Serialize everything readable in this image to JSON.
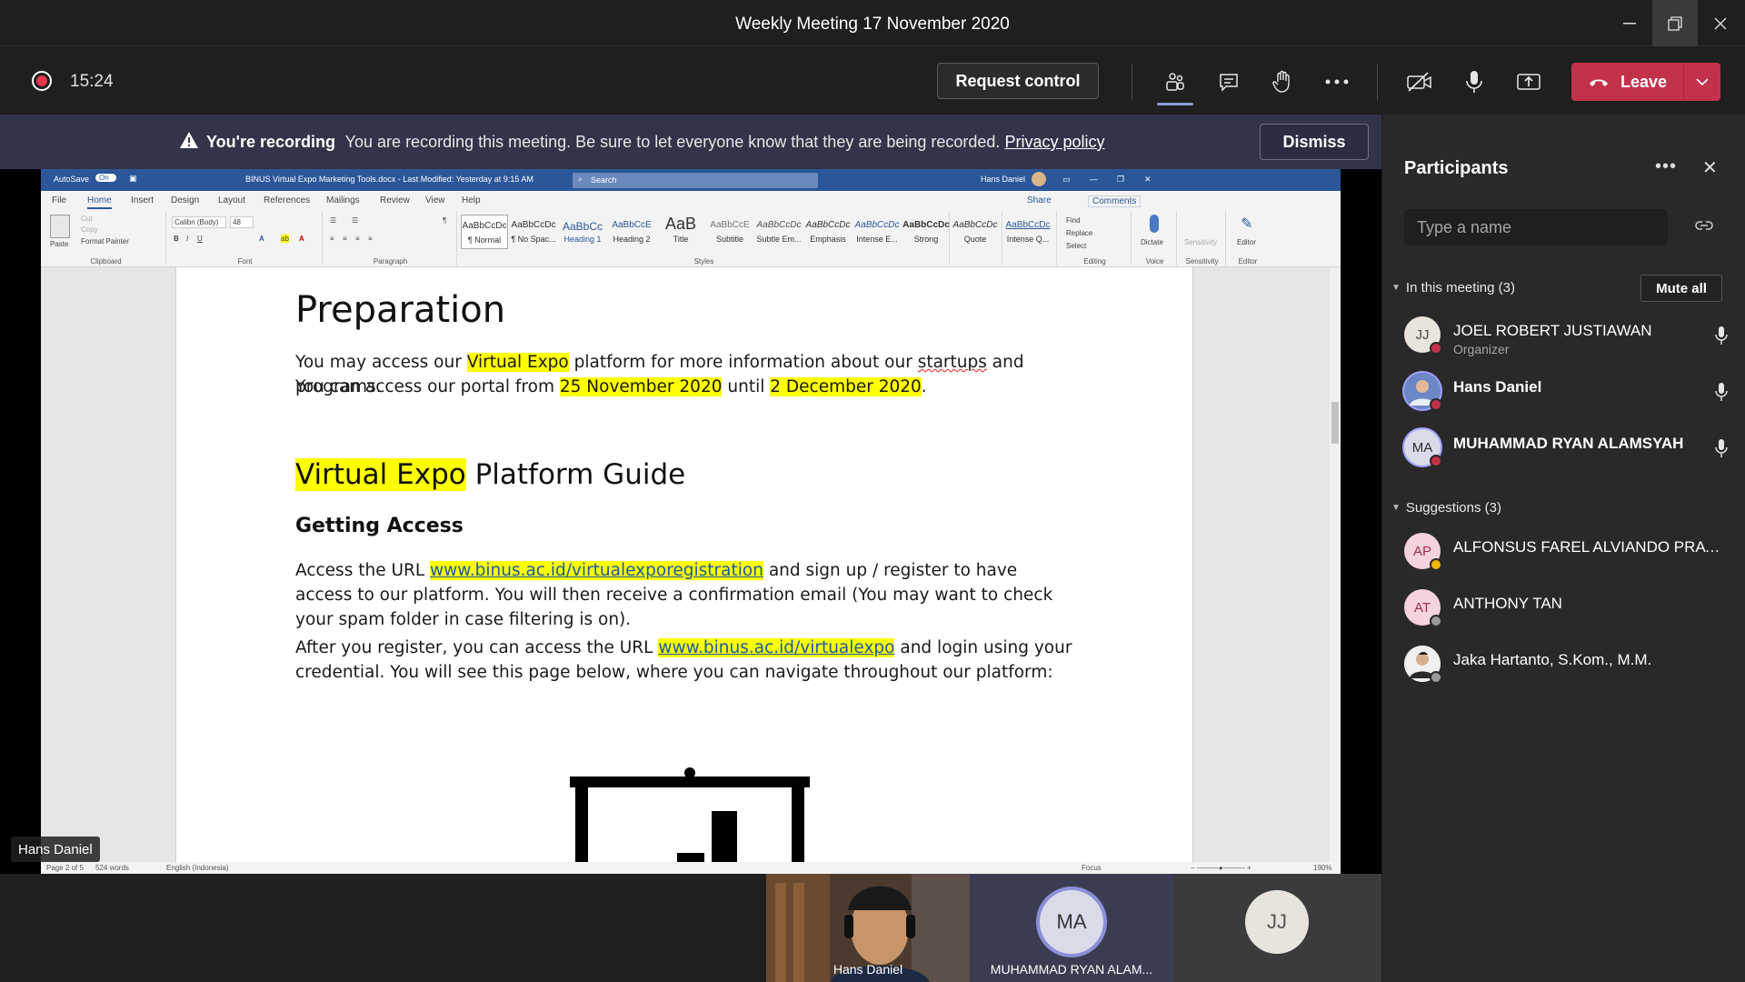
{
  "window": {
    "title": "Weekly Meeting 17 November 2020"
  },
  "controls": {
    "timer": "15:24",
    "request_control": "Request control",
    "leave": "Leave"
  },
  "banner": {
    "bold": "You're recording",
    "text": "You are recording this meeting. Be sure to let everyone know that they are being recorded.",
    "link": "Privacy policy",
    "dismiss": "Dismiss"
  },
  "word": {
    "autosave": "AutoSave",
    "autosave_state": "On",
    "doc_title": "BINUS Virtual Expo Marketing Tools.docx  -  Last Modified: Yesterday at 9:15 AM",
    "search": "Search",
    "user": "Hans Daniel",
    "tabs": [
      "File",
      "Home",
      "Insert",
      "Design",
      "Layout",
      "References",
      "Mailings",
      "Review",
      "View",
      "Help"
    ],
    "share": "Share",
    "comments": "Comments",
    "ribbon": {
      "paste": "Paste",
      "cut": "Cut",
      "copy": "Copy",
      "format_painter": "Format Painter",
      "clipboard": "Clipboard",
      "font_name": "Calibri (Body)",
      "font_size": "48",
      "font": "Font",
      "paragraph": "Paragraph",
      "styles_label": "Styles",
      "styles": [
        {
          "preview": "AaBbCcDc",
          "name": "¶ Normal"
        },
        {
          "preview": "AaBbCcDc",
          "name": "¶ No Spac..."
        },
        {
          "preview": "AaBbCc",
          "name": "Heading 1"
        },
        {
          "preview": "AaBbCcE",
          "name": "Heading 2"
        },
        {
          "preview": "AaB",
          "name": "Title"
        },
        {
          "preview": "AaBbCcE",
          "name": "Subtitle"
        },
        {
          "preview": "AaBbCcDc",
          "name": "Subtle Em..."
        },
        {
          "preview": "AaBbCcDc",
          "name": "Emphasis"
        },
        {
          "preview": "AaBbCcDc",
          "name": "Intense E..."
        },
        {
          "preview": "AaBbCcDc",
          "name": "Strong"
        },
        {
          "preview": "AaBbCcDc",
          "name": "Quote"
        },
        {
          "preview": "AaBbCcDc",
          "name": "Intense Q..."
        }
      ],
      "find": "Find",
      "replace": "Replace",
      "select": "Select",
      "editing": "Editing",
      "dictate": "Dictate",
      "voice": "Voice",
      "sensitivity": "Sensitivity",
      "editor": "Editor"
    },
    "status": {
      "page": "Page 2 of 5",
      "words": "524 words",
      "language": "English (Indonesia)",
      "focus": "Focus",
      "zoom": "190%"
    },
    "doc": {
      "h1": "Preparation",
      "p1_a": "You may access our",
      "p1_hl": "Virtual Expo",
      "p1_b": "platform for more information about our",
      "p1_sq": "startups",
      "p1_c": "and programs.",
      "p2_a": "You can access our portal from",
      "p2_d1": "25 November 2020",
      "p2_b": "until",
      "p2_d2": "2 December 2020",
      "p2_c": ".",
      "h2_hl": "Virtual Expo",
      "h2_rest": "Platform Guide",
      "h3": "Getting Access",
      "p3_a": "Access the URL",
      "p3_link": "www.binus.ac.id/virtualexporegistration",
      "p3_b": "and sign up / register to have access to our platform. You will then receive a confirmation email (You may want to check your spam folder in case filtering is on).",
      "p4_a": "After you register, you can access the URL",
      "p4_link": "www.binus.ac.id/virtualexpo",
      "p4_b": "and login using your credential. You will see this page below, where you can navigate throughout our platform:"
    }
  },
  "presenter_tag": "Hans Daniel",
  "panel": {
    "title": "Participants",
    "search_placeholder": "Type a name",
    "in_meeting": "In this meeting (3)",
    "mute_all": "Mute all",
    "suggestions": "Suggestions (3)",
    "participants": [
      {
        "initials": "JJ",
        "name": "JOEL ROBERT JUSTIAWAN",
        "role": "Organizer"
      },
      {
        "initials": "",
        "name": "Hans Daniel",
        "role": ""
      },
      {
        "initials": "MA",
        "name": "MUHAMMAD RYAN ALAMSYAH",
        "role": ""
      }
    ],
    "suggested": [
      {
        "initials": "AP",
        "name": "ALFONSUS FAREL ALVIANDO PRATA..."
      },
      {
        "initials": "AT",
        "name": "ANTHONY TAN"
      },
      {
        "initials": "",
        "name": "Jaka Hartanto, S.Kom., M.M."
      }
    ]
  },
  "tiles": [
    {
      "name": "Hans Daniel",
      "initials": ""
    },
    {
      "name": "MUHAMMAD RYAN ALAM...",
      "initials": "MA"
    },
    {
      "name": "",
      "initials": "JJ"
    }
  ],
  "colors": {
    "leave": "#c4314b",
    "banner": "#32344a",
    "word_blue": "#2b579a",
    "highlight": "#ffff00",
    "recording": "#e4374b"
  }
}
